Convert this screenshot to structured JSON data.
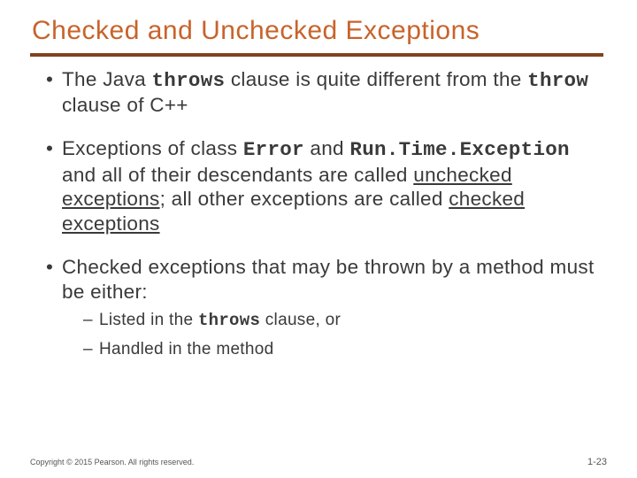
{
  "title": "Checked and Unchecked Exceptions",
  "bullets": {
    "b1": {
      "t1": "The Java ",
      "code1": "throws",
      "t2": " clause is quite different from the ",
      "code2": "throw",
      "t3": " clause of C++"
    },
    "b2": {
      "t1": "Exceptions of class ",
      "code1": "Error",
      "t2": " and ",
      "code2": "Run.Time.Exception",
      "t3": " and all of their descendants are called ",
      "u1": "unchecked exceptions",
      "t4": "; all other exceptions are called ",
      "u2": "checked exceptions"
    },
    "b3": {
      "t1": "Checked exceptions that may be thrown by a method must be either:",
      "sub1": {
        "t1": "Listed in the ",
        "code1": "throws",
        "t2": " clause, or"
      },
      "sub2": {
        "t1": "Handled in the method"
      }
    }
  },
  "footer": {
    "copyright": "Copyright © 2015 Pearson. All rights reserved.",
    "page": "1-23"
  }
}
